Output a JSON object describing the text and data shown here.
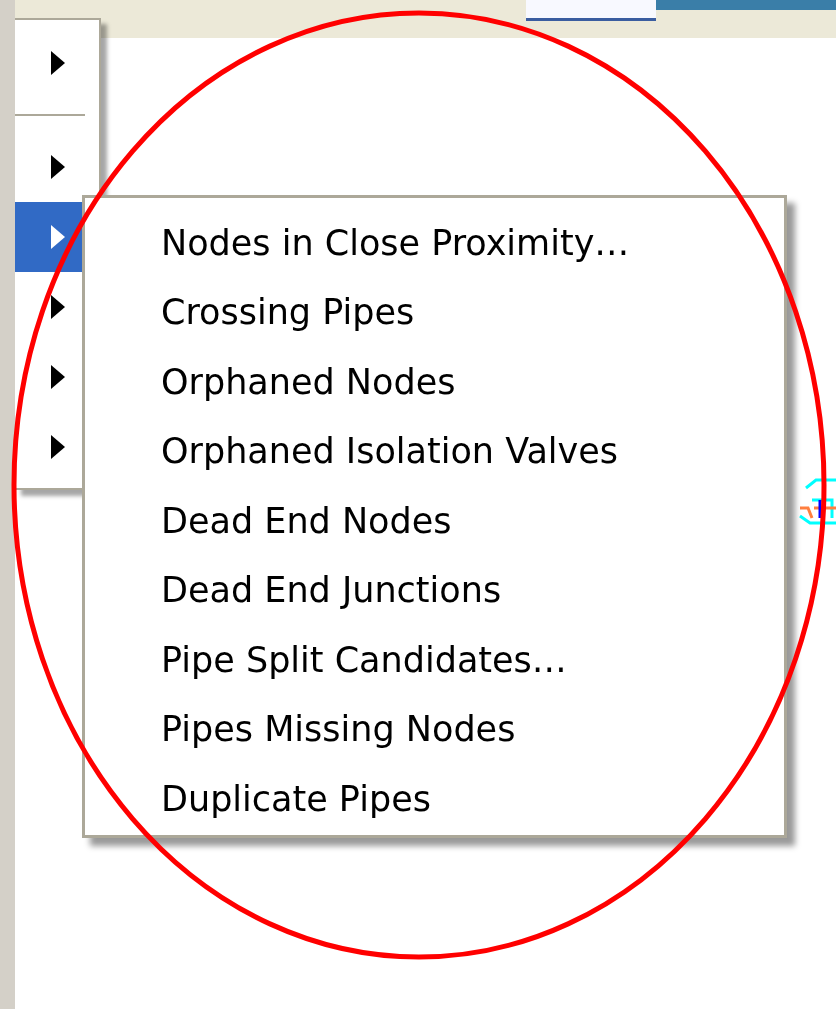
{
  "parent_menu": {
    "items": [
      {
        "kind": "submenu",
        "selected": false
      },
      {
        "kind": "separator"
      },
      {
        "kind": "submenu",
        "selected": false
      },
      {
        "kind": "submenu",
        "selected": true
      },
      {
        "kind": "submenu",
        "selected": false
      },
      {
        "kind": "submenu",
        "selected": false
      },
      {
        "kind": "submenu",
        "selected": false
      }
    ]
  },
  "submenu": {
    "items": [
      {
        "label": "Nodes in Close Proximity…"
      },
      {
        "label": "Crossing Pipes"
      },
      {
        "label": "Orphaned Nodes"
      },
      {
        "label": "Orphaned Isolation Valves"
      },
      {
        "label": "Dead End Nodes"
      },
      {
        "label": "Dead End Junctions"
      },
      {
        "label": "Pipe Split Candidates…"
      },
      {
        "label": "Pipes Missing Nodes"
      },
      {
        "label": "Duplicate Pipes"
      }
    ]
  }
}
